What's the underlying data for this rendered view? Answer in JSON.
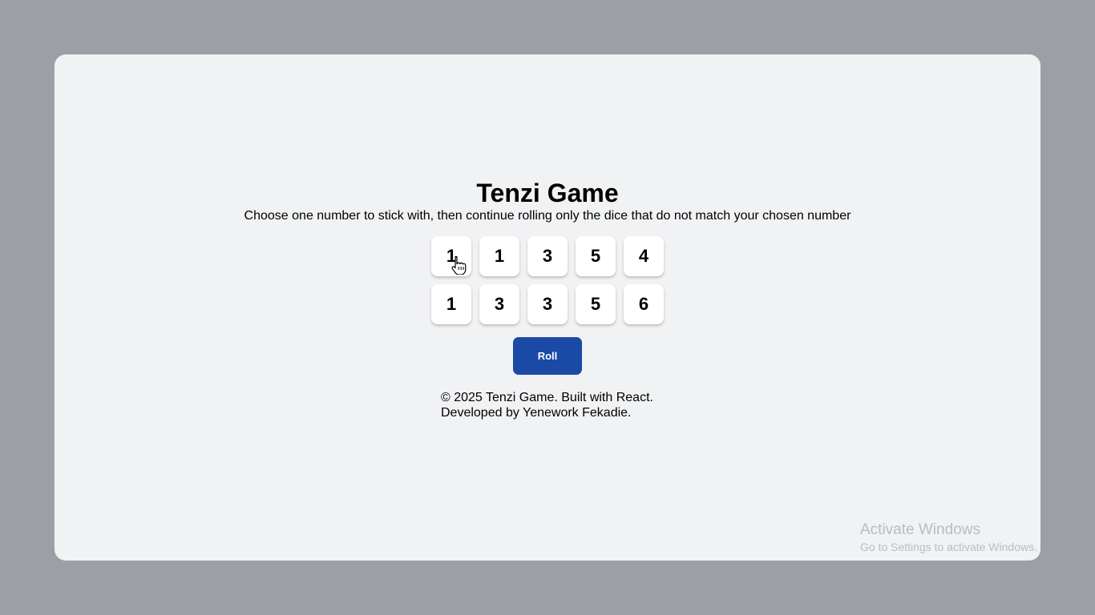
{
  "game": {
    "title": "Tenzi Game",
    "instructions": "Choose one number to stick with, then continue rolling only the dice that do not match your chosen number",
    "dice": [
      {
        "value": "1"
      },
      {
        "value": "1"
      },
      {
        "value": "3"
      },
      {
        "value": "5"
      },
      {
        "value": "4"
      },
      {
        "value": "1"
      },
      {
        "value": "3"
      },
      {
        "value": "3"
      },
      {
        "value": "5"
      },
      {
        "value": "6"
      }
    ],
    "roll_label": "Roll"
  },
  "footer": {
    "copyright": "© 2025 Tenzi Game. Built with React.",
    "developer": "Developed by Yenework Fekadie."
  },
  "os_watermark": {
    "title": "Activate Windows",
    "subtitle": "Go to Settings to activate Windows."
  },
  "colors": {
    "page_bg": "#9ca0a6",
    "card_bg": "#f1f2f4",
    "die_bg": "#ffffff",
    "button_bg": "#1a4aa5",
    "button_text": "#ffffff"
  },
  "icons": {
    "cursor": "hand-pointer-cursor"
  }
}
